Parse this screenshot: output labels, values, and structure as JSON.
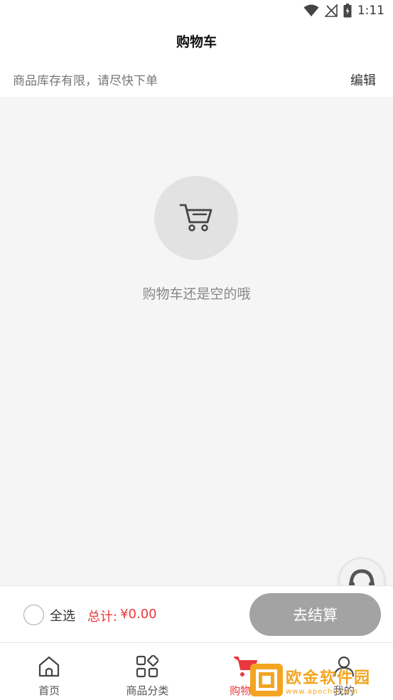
{
  "statusbar": {
    "time": "1:11"
  },
  "header": {
    "title": "购物车"
  },
  "notice": {
    "text": "商品库存有限，请尽快下单",
    "edit_label": "编辑"
  },
  "empty_state": {
    "icon": "cart-icon",
    "message": "购物车还是空的哦"
  },
  "service": {
    "icon": "headset-icon"
  },
  "checkout": {
    "select_all_label": "全选",
    "total_label": "总计:",
    "total_amount": "¥0.00",
    "button_label": "去结算"
  },
  "tabbar": {
    "items": [
      {
        "label": "首页",
        "icon": "home-icon"
      },
      {
        "label": "商品分类",
        "icon": "grid-icon"
      },
      {
        "label": "购物车",
        "icon": "cart-icon"
      },
      {
        "label": "我的",
        "icon": "user-icon"
      }
    ]
  },
  "watermark": {
    "text": "欧金软件园",
    "sub": "www.apochu.com"
  },
  "colors": {
    "accent": "#e8383d",
    "background": "#f5f5f5",
    "button_disabled": "#a3a3a3",
    "watermark": "#f3a522"
  }
}
